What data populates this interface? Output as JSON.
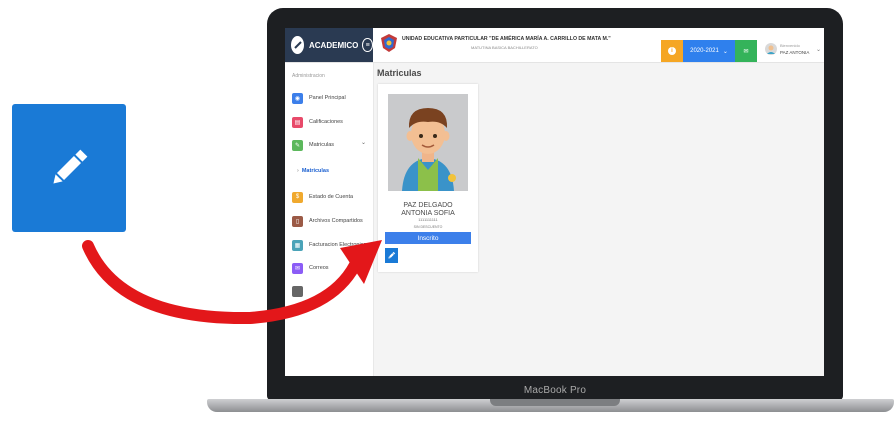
{
  "colors": {
    "accent_blue": "#1a7ad6",
    "sidebar_dark": "#2a3a52",
    "arrow_red": "#e3171a"
  },
  "header": {
    "brand": "ACADEMICO",
    "school_name": "UNIDAD EDUCATIVA PARTICULAR \"DE AMÉRICA MARÍA A. CARRILLO DE MATA M.\"",
    "school_subtitle": "MATUTINA BASICA BACHILLERATO",
    "period": "2020-2021",
    "user_greeting": "Bienvenido",
    "user_name": "PAZ ANTONIA"
  },
  "sidebar": {
    "section": "Administracion",
    "items": [
      {
        "label": "Panel Principal",
        "color": "#3c7fea",
        "icon": "eye-icon"
      },
      {
        "label": "Calificaciones",
        "color": "#e84a6a",
        "icon": "clipboard-icon"
      },
      {
        "label": "Matriculas",
        "color": "#5cb85c",
        "icon": "edit-doc-icon"
      },
      {
        "label": "Estado de Cuenta",
        "color": "#f0a92e",
        "icon": "dollar-icon"
      },
      {
        "label": "Archivos Compartidos",
        "color": "#9b5a46",
        "icon": "file-icon"
      },
      {
        "label": "Facturacion Electronica",
        "color": "#4aa3b8",
        "icon": "invoice-icon"
      },
      {
        "label": "Correos",
        "color": "#8b5cf6",
        "icon": "mail-icon"
      }
    ],
    "sub_item": "Matriculas"
  },
  "main": {
    "title": "Matriculas",
    "student_name_1": "PAZ DELGADO",
    "student_name_2": "ANTONIA SOFIA",
    "student_code": "1111111111",
    "discount": "SIN DESCUENTO",
    "status": "Inscrito"
  },
  "laptop": {
    "label": "MacBook Pro"
  }
}
